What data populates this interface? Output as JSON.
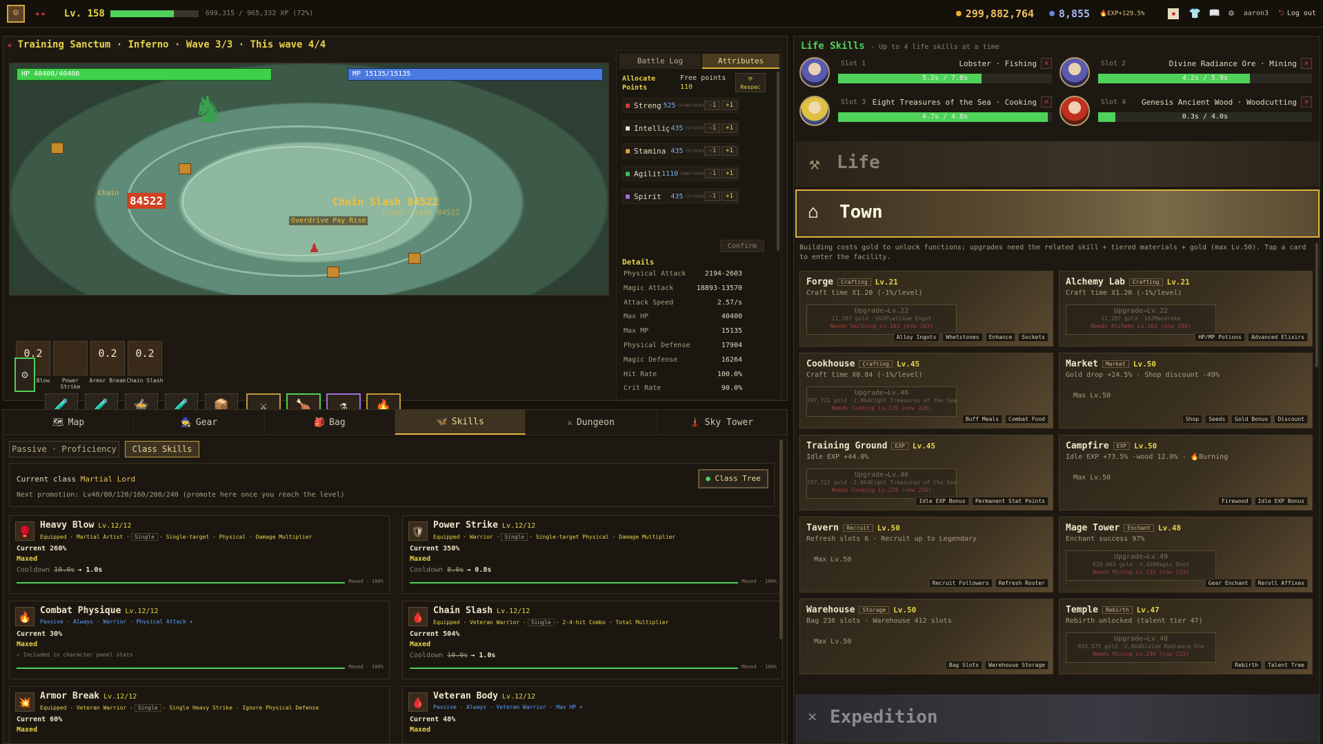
{
  "topbar": {
    "level": "Lv. 158",
    "xp_text": "699,315 / 965,332 XP (72%)",
    "xp_progress": 0.72,
    "gold": "299,882,764",
    "gems": "8,855",
    "exp_bonus": "🔥EXP+129.5%",
    "username": "aaron3",
    "logout": "Log out"
  },
  "battle": {
    "title": "Training Sanctum · Inferno · Wave 3/3 · This wave 4/4",
    "hp": "HP 40400/40400",
    "mp": "MP 15135/15135",
    "dmg1": "Chain Slash 84522",
    "dmg2": "84522",
    "dmg3": "Chain Slash 84522",
    "float1": "Chain",
    "float2": "Overdrive Pay Rise"
  },
  "skill_slots": [
    {
      "num": "0.2",
      "name": "Heavy Blow"
    },
    {
      "num": "",
      "name": "Power Strike"
    },
    {
      "num": "0.2",
      "name": "Armor Break"
    },
    {
      "num": "0.2",
      "name": "Chain Slash"
    }
  ],
  "hotbar": [
    {
      "val": "7017",
      "icon": "🧪"
    },
    {
      "val": "2643",
      "icon": "🧪"
    },
    {
      "val": "445s",
      "icon": "🍲"
    },
    {
      "val": "1546s",
      "icon": "🧪"
    },
    {
      "val": "678s",
      "icon": "📦"
    }
  ],
  "buffs": [
    {
      "val": "11m",
      "icon": "⚔"
    },
    {
      "val": "7m",
      "icon": "🍗"
    },
    {
      "val": "25m",
      "icon": "⚗"
    },
    {
      "val": "-",
      "icon": "🔥"
    }
  ],
  "side": {
    "tab1": "Battle Log",
    "tab2": "Attributes",
    "alloc": "Allocate Points",
    "free_label": "Free points",
    "free": "110",
    "respec": "Respec",
    "confirm": "Confirm",
    "details": "Details",
    "attrs": [
      {
        "name": "Strength",
        "val": "525",
        "bonus": "(5+90+T430)",
        "color": "#d04040"
      },
      {
        "name": "Intellige…",
        "val": "435",
        "bonus": "(5+T430)",
        "color": "#e0e0e0"
      },
      {
        "name": "Stamina",
        "val": "435",
        "bonus": "(5+T430)",
        "color": "#e0a040"
      },
      {
        "name": "Agility",
        "val": "1110",
        "bonus": "(680+T430)",
        "color": "#40c060"
      },
      {
        "name": "Spirit",
        "val": "435",
        "bonus": "(5+T430)",
        "color": "#a070e0"
      }
    ],
    "minus": "-1",
    "plus": "+1",
    "stats": [
      {
        "k": "Physical Attack",
        "v": "2194-2603"
      },
      {
        "k": "Magic Attack",
        "v": "18893-13570"
      },
      {
        "k": "Attack Speed",
        "v": "2.57/s"
      },
      {
        "k": "Max HP",
        "v": "40400"
      },
      {
        "k": "Max MP",
        "v": "15135"
      },
      {
        "k": "Physical Defense",
        "v": "17904"
      },
      {
        "k": "Magic Defense",
        "v": "16264"
      },
      {
        "k": "Hit Rate",
        "v": "100.0%"
      },
      {
        "k": "Crit Rate",
        "v": "90.0%"
      }
    ]
  },
  "navtabs": [
    {
      "label": "Map",
      "icon": "🗺"
    },
    {
      "label": "Gear",
      "icon": "🧙"
    },
    {
      "label": "Bag",
      "icon": "🎒"
    },
    {
      "label": "Skills",
      "icon": "🦋"
    },
    {
      "label": "Dungeon",
      "icon": "⚔"
    },
    {
      "label": "Sky Tower",
      "icon": "🗼"
    }
  ],
  "skills": {
    "subtab1": "Passive · Proficiency",
    "subtab2": "Class Skills",
    "current_class_label": "Current class",
    "current_class": "Martial Lord",
    "promo": "Next promotion: Lv40/80/120/160/200/240 (promote here once you reach the level)",
    "class_tree": "Class Tree",
    "cards": [
      {
        "name": "Heavy Blow",
        "lv": "Lv.12/12",
        "tags": "Equipped · Martial Artist ·",
        "single": "Single",
        "tags2": "· Single-target · Physical · Damage Multiplier",
        "current": "Current 260%",
        "maxed": "Maxed",
        "cd": "Cooldown",
        "cd_old": "10.0s",
        "cd_new": "→ 1.0s",
        "bar": "Maxed · 100%",
        "icon": "🥊"
      },
      {
        "name": "Power Strike",
        "lv": "Lv.12/12",
        "tags": "Equipped · Warrior ·",
        "single": "Single",
        "tags2": "· Single-target Physical · Damage Multiplier",
        "current": "Current 350%",
        "maxed": "Maxed",
        "cd": "Cooldown",
        "cd_old": "8.0s",
        "cd_new": "→ 0.8s",
        "bar": "Maxed · 100%",
        "icon": "🛡"
      },
      {
        "name": "Combat Physique",
        "lv": "Lv.12/12",
        "tags": "Passive · Always · Warrior · Physical Attack +",
        "single": "",
        "tags2": "",
        "current": "Current 30%",
        "maxed": "Maxed",
        "cd": "✓ Included in character panel stats",
        "cd_old": "",
        "cd_new": "",
        "bar": "Maxed · 100%",
        "icon": "🔥"
      },
      {
        "name": "Chain Slash",
        "lv": "Lv.12/12",
        "tags": "Equipped · Veteran Warrior ·",
        "single": "Single",
        "tags2": "· 2-4-hit Combo · Total Multiplier",
        "current": "Current 504%",
        "maxed": "Maxed",
        "cd": "Cooldown",
        "cd_old": "10.0s",
        "cd_new": "→ 1.0s",
        "bar": "Maxed · 100%",
        "icon": "🩸"
      },
      {
        "name": "Armor Break",
        "lv": "Lv.12/12",
        "tags": "Equipped · Veteran Warrior ·",
        "single": "Single",
        "tags2": "· Single Heavy Strike · Ignore Physical Defense",
        "current": "Current 60%",
        "maxed": "Maxed",
        "cd": "",
        "cd_old": "",
        "cd_new": "",
        "bar": "",
        "icon": "💥"
      },
      {
        "name": "Veteran Body",
        "lv": "Lv.12/12",
        "tags": "Passive · Always · Veteran Warrior · Max HP +",
        "single": "",
        "tags2": "",
        "current": "Current 48%",
        "maxed": "Maxed",
        "cd": "",
        "cd_old": "",
        "cd_new": "",
        "bar": "",
        "icon": "🩸"
      }
    ]
  },
  "life": {
    "title": "Life Skills",
    "subtitle": "· Up to 4 life skills at a time",
    "close": "×",
    "slots": [
      {
        "slot": "Slot 1",
        "task": "Lobster · Fishing",
        "prog": "5.2s / 7.8s",
        "pct": 0.67
      },
      {
        "slot": "Slot 2",
        "task": "Divine Radiance Ore · Mining",
        "prog": "4.2s / 5.9s",
        "pct": 0.71
      },
      {
        "slot": "Slot 3",
        "task": "Eight Treasures of the Sea · Cooking",
        "prog": "4.7s / 4.8s",
        "pct": 0.98
      },
      {
        "slot": "Slot 4",
        "task": "Genesis Ancient Wood · Woodcutting",
        "prog": "0.3s / 4.0s",
        "pct": 0.08
      }
    ],
    "life_banner": "Life",
    "town_banner": "Town",
    "expedition_banner": "Expedition",
    "town_desc": "Building costs gold to unlock functions; upgrades need the related skill + tiered materials + gold (max Lv.50). Tap a card to enter the facility."
  },
  "buildings": [
    {
      "name": "Forge",
      "type": "Crafting",
      "lv": "Lv.21",
      "desc": "Craft time X1.20 (-1%/level)",
      "upg": "Upgrade→Lv.22",
      "cost": "11,287 gold ·162Platinum Ingot",
      "need": "Needs Smithing Lv.163 (now 163)",
      "chips": [
        "Alloy Ingots",
        "Whetstones",
        "Enhance",
        "Sockets"
      ]
    },
    {
      "name": "Alchemy Lab",
      "type": "Crafting",
      "lv": "Lv.21",
      "desc": "Craft time X1.20 (-1%/level)",
      "upg": "Upgrade→Lv.22",
      "cost": "11,287 gold ·162Mandrake",
      "need": "Needs Alchemy Lv.163 (now 194)",
      "chips": [
        "HP/MP Potions",
        "Advanced Elixirs"
      ]
    },
    {
      "name": "Cookhouse",
      "type": "Crafting",
      "lv": "Lv.45",
      "desc": "Craft time X0.84 (-1%/level)",
      "upg": "Upgrade→Lv.46",
      "cost": "397,722 gold ·2,864Eight Treasures of the Sea",
      "need": "Needs Cooking Lv.229 (now 226)",
      "chips": [
        "Buff Meals",
        "Combat Food"
      ]
    },
    {
      "name": "Market",
      "type": "Market",
      "lv": "Lv.50",
      "desc": "Gold drop +24.5% · Shop discount -49%",
      "upg": "",
      "cost": "",
      "need": "",
      "max": "Max Lv.50",
      "chips": [
        "Shop",
        "Seeds",
        "Gold Bonus",
        "Discount"
      ]
    },
    {
      "name": "Training Ground",
      "type": "EXP",
      "lv": "Lv.45",
      "desc": "Idle EXP +44.0%",
      "upg": "Upgrade→Lv.46",
      "cost": "397,722 gold ·2,864Eight Treasures of the Sea",
      "need": "Needs Cooking Lv.229 (now 226)",
      "chips": [
        "Idle EXP Bonus",
        "Permanent Stat Points"
      ]
    },
    {
      "name": "Campfire",
      "type": "EXP",
      "lv": "Lv.50",
      "desc": "Idle EXP +73.5% ·wood 12.0% · 🔥Burning",
      "upg": "",
      "cost": "",
      "need": "",
      "max": "Max Lv.50",
      "chips": [
        "Firewood",
        "Idle EXP Bonus"
      ]
    },
    {
      "name": "Tavern",
      "type": "Recruit",
      "lv": "Lv.50",
      "desc": "Refresh slots 6 · Recruit up to Legendary",
      "upg": "",
      "cost": "",
      "need": "",
      "max": "Max Lv.50",
      "chips": [
        "Recruit Followers",
        "Refresh Roster"
      ]
    },
    {
      "name": "Mage Tower",
      "type": "Enchant",
      "lv": "Lv.48",
      "desc": "Enchant success 97%",
      "upg": "Upgrade→Lv.49",
      "cost": "629,863 gold ·3,456Magic Dust",
      "need": "Needs Mining Lv.235 (now 233)",
      "chips": [
        "Gear Enchant",
        "Reroll Affixes"
      ]
    },
    {
      "name": "Warehouse",
      "type": "Storage",
      "lv": "Lv.50",
      "desc": "Bag 236 slots · Warehouse 412 slots",
      "upg": "",
      "cost": "",
      "need": "",
      "max": "Max Lv.50",
      "chips": [
        "Bag Slots",
        "Warehouse Storage"
      ]
    },
    {
      "name": "Temple",
      "type": "Rebirth",
      "lv": "Lv.47",
      "desc": "Rebirth unlocked (talent tier 47)",
      "upg": "Upgrade→Lv.48",
      "cost": "839,575 gold ·2,864Divine Radiance Ore",
      "need": "Needs Mining Lv.236 (now 233)",
      "chips": [
        "Rebirth",
        "Talent Tree"
      ]
    }
  ],
  "colors": {
    "hp": "#3fd04a",
    "mp": "#4a7ae0",
    "accent": "#e0b040",
    "bg": "#15120c"
  }
}
